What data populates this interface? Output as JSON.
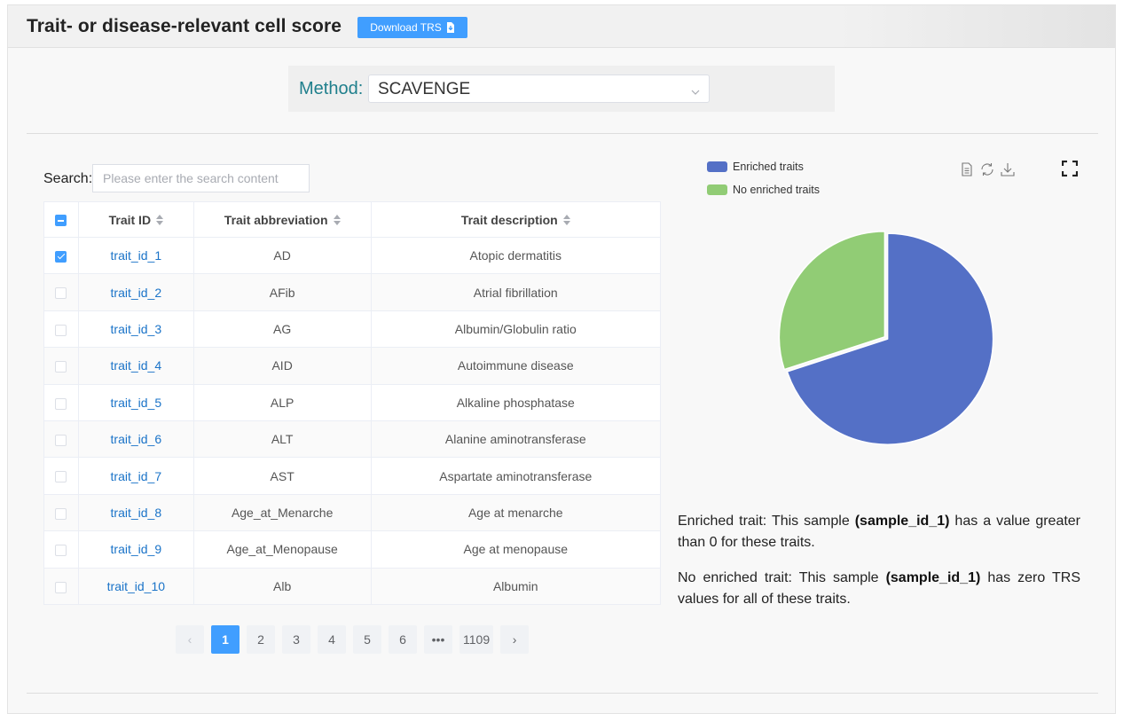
{
  "header": {
    "title": "Trait- or disease-relevant cell score",
    "download_label": "Download TRS"
  },
  "method": {
    "label": "Method:",
    "selected": "SCAVENGE"
  },
  "search": {
    "label": "Search:",
    "placeholder": "Please enter the search content"
  },
  "table": {
    "columns": [
      "Trait ID",
      "Trait abbreviation",
      "Trait description"
    ],
    "header_checkbox": "indeterminate",
    "rows": [
      {
        "id": "trait_id_1",
        "abbr": "AD",
        "desc": "Atopic dermatitis",
        "checked": true
      },
      {
        "id": "trait_id_2",
        "abbr": "AFib",
        "desc": "Atrial fibrillation",
        "checked": false
      },
      {
        "id": "trait_id_3",
        "abbr": "AG",
        "desc": "Albumin/Globulin ratio",
        "checked": false
      },
      {
        "id": "trait_id_4",
        "abbr": "AID",
        "desc": "Autoimmune disease",
        "checked": false
      },
      {
        "id": "trait_id_5",
        "abbr": "ALP",
        "desc": "Alkaline phosphatase",
        "checked": false
      },
      {
        "id": "trait_id_6",
        "abbr": "ALT",
        "desc": "Alanine aminotransferase",
        "checked": false
      },
      {
        "id": "trait_id_7",
        "abbr": "AST",
        "desc": "Aspartate aminotransferase",
        "checked": false
      },
      {
        "id": "trait_id_8",
        "abbr": "Age_at_Menarche",
        "desc": "Age at menarche",
        "checked": false
      },
      {
        "id": "trait_id_9",
        "abbr": "Age_at_Menopause",
        "desc": "Age at menopause",
        "checked": false
      },
      {
        "id": "trait_id_10",
        "abbr": "Alb",
        "desc": "Albumin",
        "checked": false
      }
    ]
  },
  "pagination": {
    "prev": "‹",
    "next": "›",
    "pages": [
      "1",
      "2",
      "3",
      "4",
      "5",
      "6",
      "•••",
      "1109"
    ],
    "active": "1"
  },
  "chart_data": {
    "type": "pie",
    "legend_position": "top-left",
    "series": [
      {
        "name": "Enriched traits",
        "value": 70,
        "color": "#5470c6"
      },
      {
        "name": "No enriched traits",
        "value": 30,
        "color": "#91cc75"
      }
    ]
  },
  "descriptions": {
    "enriched_prefix": "Enriched trait: This sample ",
    "enriched_sample": "(sample_id_1)",
    "enriched_suffix": " has a value greater than 0 for these traits.",
    "none_prefix": "No enriched trait: This sample ",
    "none_sample": "(sample_id_1)",
    "none_suffix": " has zero TRS values for all of these traits."
  }
}
